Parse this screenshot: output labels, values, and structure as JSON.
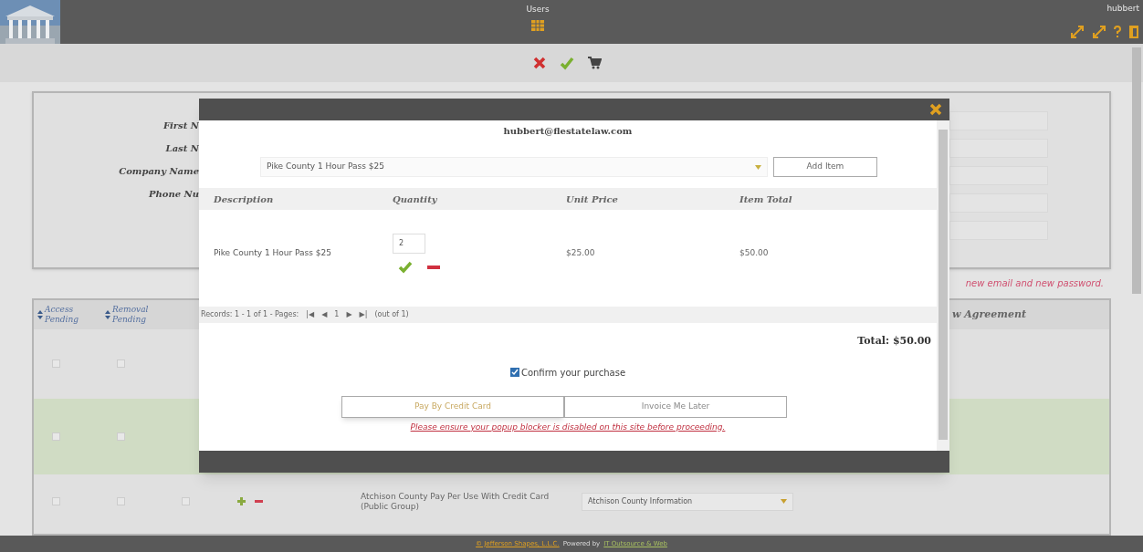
{
  "header": {
    "title": "Users",
    "user": "hubbert"
  },
  "toolbar": {
    "actions": [
      {
        "kind": "cancel"
      },
      {
        "kind": "save"
      },
      {
        "kind": "cart"
      }
    ]
  },
  "form": {
    "labels": [
      "First N",
      "Last N",
      "Company Name",
      "Phone Nu"
    ],
    "note": "new email and new password."
  },
  "grid": {
    "columns": [
      "Access Pending",
      "Removal Pending"
    ],
    "column_last": "w Agreement",
    "rows": [
      {
        "selected": false
      },
      {
        "selected": true
      },
      {
        "selected": false,
        "group": "Atchison County Pay Per Use With Credit Card (Public Group)",
        "dropdown": "Atchison County Information"
      }
    ]
  },
  "modal": {
    "email": "hubbert@flestatelaw.com",
    "item_select": "Pike County 1 Hour Pass $25",
    "add_button": "Add Item",
    "columns": [
      "Description",
      "Quantity",
      "Unit Price",
      "Item Total"
    ],
    "rows": [
      {
        "description": "Pike County 1 Hour Pass $25",
        "quantity": "2",
        "unit_price": "$25.00",
        "item_total": "$50.00"
      }
    ],
    "pager": [
      "Records: 1 - 1 of 1 - Pages:",
      "|◀",
      "◀",
      "1",
      "▶",
      "▶|",
      "(out of 1)"
    ],
    "total": "Total: $50.00",
    "confirm": {
      "label": "Confirm your purchase",
      "checked": true
    },
    "buttons": [
      {
        "label": "Pay By Credit Card",
        "selected": true
      },
      {
        "label": "Invoice Me Later",
        "selected": false
      }
    ],
    "warning": "Please ensure your popup blocker is disabled on this site before proceeding."
  },
  "footer": {
    "copyright": "© Jefferson Shapes, L.L.C.",
    "powered": "Powered by",
    "link": "IT Outsource & Web"
  }
}
